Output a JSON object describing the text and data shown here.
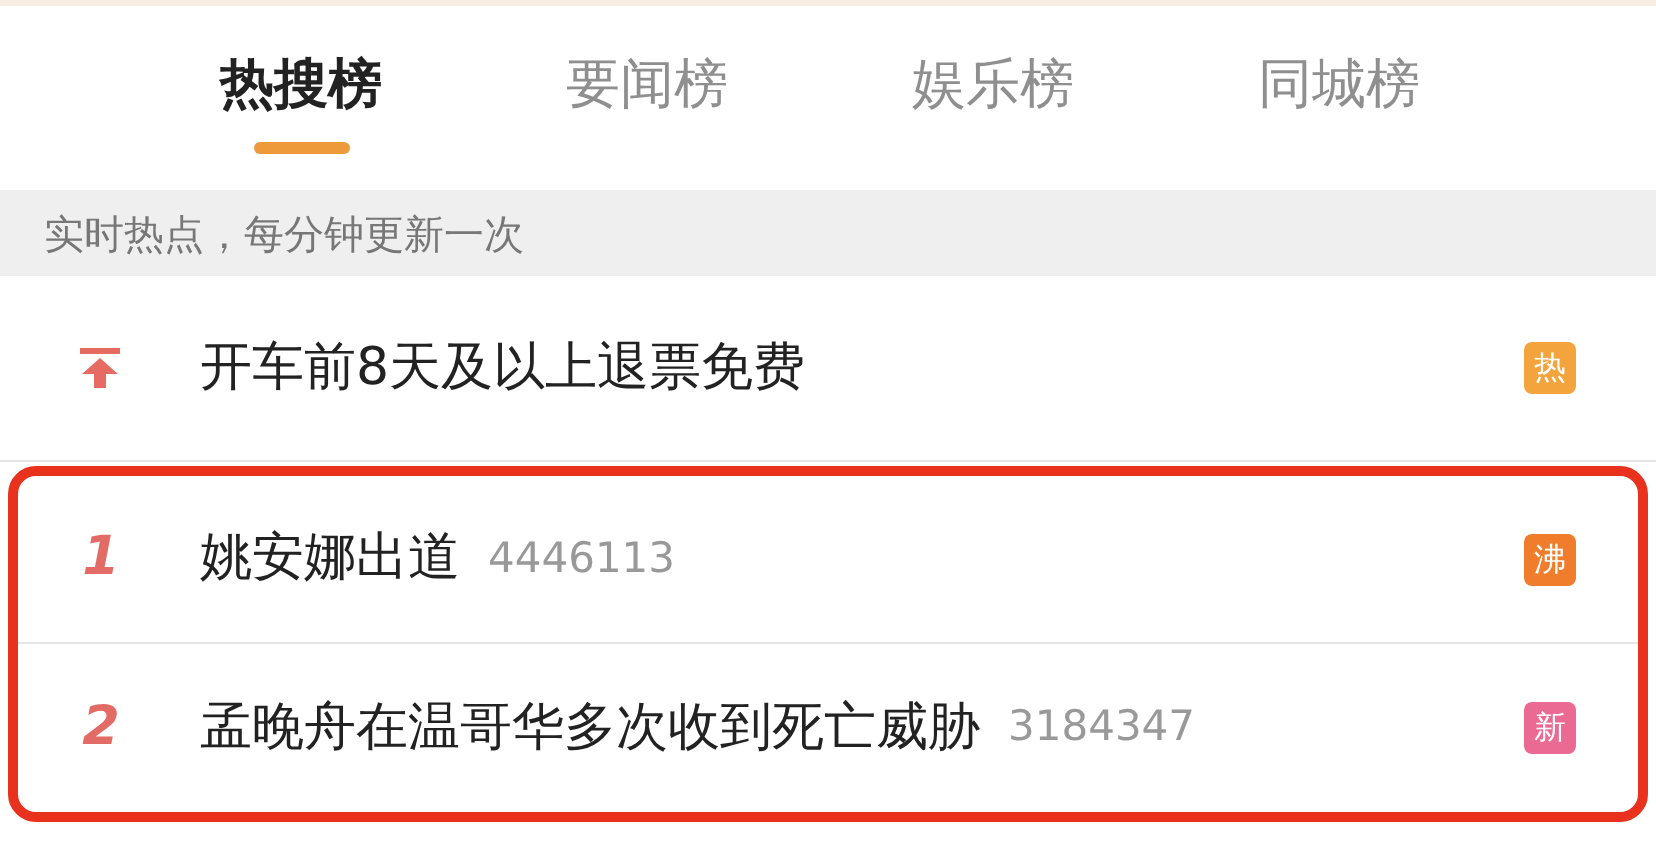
{
  "tabs": [
    {
      "label": "热搜榜",
      "selected": true
    },
    {
      "label": "要闻榜",
      "selected": false
    },
    {
      "label": "娱乐榜",
      "selected": false
    },
    {
      "label": "同城榜",
      "selected": false
    }
  ],
  "notice": "实时热点，每分钟更新一次",
  "rows": [
    {
      "kind": "pinned",
      "title": "开车前8天及以上退票免费",
      "badge": "热",
      "color": "#f3a43c",
      "highlighted": false
    },
    {
      "kind": "ranked",
      "rank": "1",
      "title": "姚安娜出道",
      "count": "4446113",
      "badge": "沸",
      "color": "#f07d2c",
      "highlighted": true
    },
    {
      "kind": "ranked",
      "rank": "2",
      "title": "孟晚舟在温哥华多次收到死亡威胁",
      "count": "3184347",
      "badge": "新",
      "color": "#eb6a94",
      "highlighted": true
    }
  ]
}
